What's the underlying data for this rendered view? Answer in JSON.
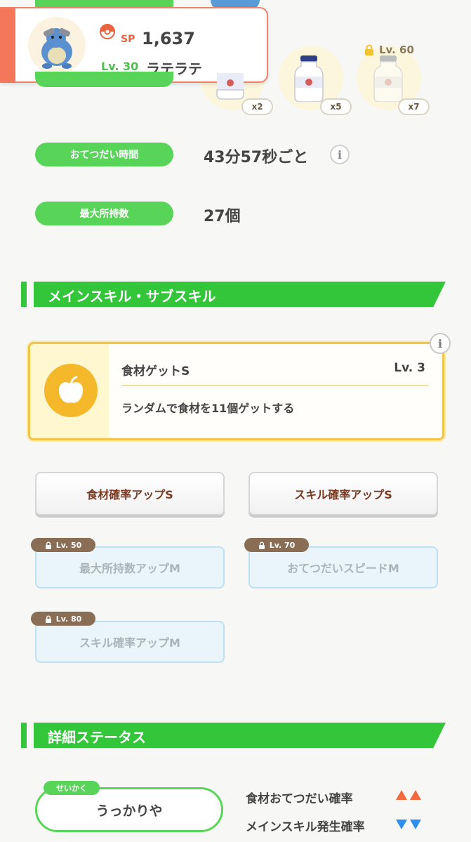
{
  "popup": {
    "sp_label": "SP",
    "sp_value": "1,637",
    "level": "Lv. 30",
    "name": "ラテラテ"
  },
  "ingredients": [
    {
      "count": "x2",
      "locked": false
    },
    {
      "count": "x5",
      "locked": false
    },
    {
      "count": "x7",
      "locked": true,
      "lock_level": "Lv. 60"
    }
  ],
  "rows": [
    {
      "label": "おてつだい時間",
      "value": "43分57秒ごと",
      "has_info": true
    },
    {
      "label": "最大所持数",
      "value": "27個",
      "has_info": false
    }
  ],
  "skills_section": {
    "title": "メインスキル・サブスキル",
    "main_skill": {
      "name": "食材ゲットS",
      "level": "Lv. 3",
      "description": "ランダムで食材を11個ゲットする",
      "icon": "apple-icon"
    },
    "sub_skills": [
      {
        "label": "食材確率アップS",
        "locked": false
      },
      {
        "label": "スキル確率アップS",
        "locked": false
      },
      {
        "label": "最大所持数アップM",
        "locked": true,
        "lock_level": "Lv. 50"
      },
      {
        "label": "おてつだいスピードM",
        "locked": true,
        "lock_level": "Lv. 70"
      },
      {
        "label": "スキル確率アップM",
        "locked": true,
        "lock_level": "Lv. 80"
      }
    ]
  },
  "details_section": {
    "title": "詳細ステータス",
    "nature_tag": "せいかく",
    "nature": "うっかりや",
    "effects": [
      {
        "label": "食材おてつだい確率",
        "direction": "up",
        "color": "#f26a3d"
      },
      {
        "label": "メインスキル発生確率",
        "direction": "down",
        "color": "#2d8ff0"
      }
    ]
  },
  "colors": {
    "green": "#58d558",
    "section_green": "#33c63a",
    "accent_orange": "#f4765b",
    "skill_gold": "#f5b82a"
  }
}
